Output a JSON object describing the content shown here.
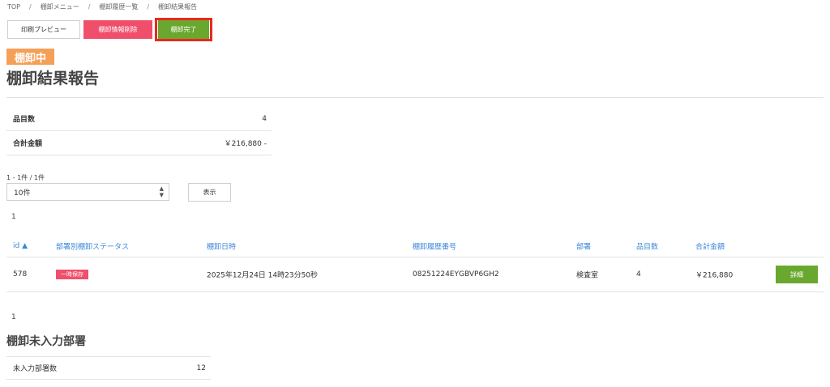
{
  "breadcrumb": {
    "items": [
      "TOP",
      "棚卸メニュー",
      "棚卸履歴一覧",
      "棚卸結果報告"
    ],
    "separator": "/"
  },
  "toolbar": {
    "print_label": "印刷プレビュー",
    "delete_label": "棚卸情報削除",
    "complete_label": "棚卸完了"
  },
  "status": {
    "label": "棚卸中"
  },
  "page_title": "棚卸結果報告",
  "summary": [
    {
      "label": "品目数",
      "value": "4"
    },
    {
      "label": "合計金額",
      "value": "￥216,880 -"
    }
  ],
  "pager": {
    "info": "1 - 1件 / 1件",
    "per_page": "10件",
    "show_label": "表示",
    "page_top": "1",
    "page_bottom": "1"
  },
  "table": {
    "headers": [
      "id ▲",
      "部署別棚卸ステータス",
      "棚卸日時",
      "棚卸履歴番号",
      "部署",
      "品目数",
      "合計金額"
    ],
    "rows": [
      {
        "id": "578",
        "status": "一時保存",
        "datetime": "2025年12月24日 14時23分50秒",
        "history_no": "08251224EYGBVP6GH2",
        "department": "検査室",
        "items": "4",
        "total": "￥216,880",
        "detail_label": "詳細"
      }
    ]
  },
  "unentered": {
    "title": "棚卸未入力部署",
    "label": "未入力部署数",
    "value": "12"
  },
  "colors": {
    "delete": "#f04f6c",
    "complete": "#6aa72e",
    "highlight": "#e8291c",
    "status_tag": "#f5a057",
    "link": "#3a86d8"
  }
}
